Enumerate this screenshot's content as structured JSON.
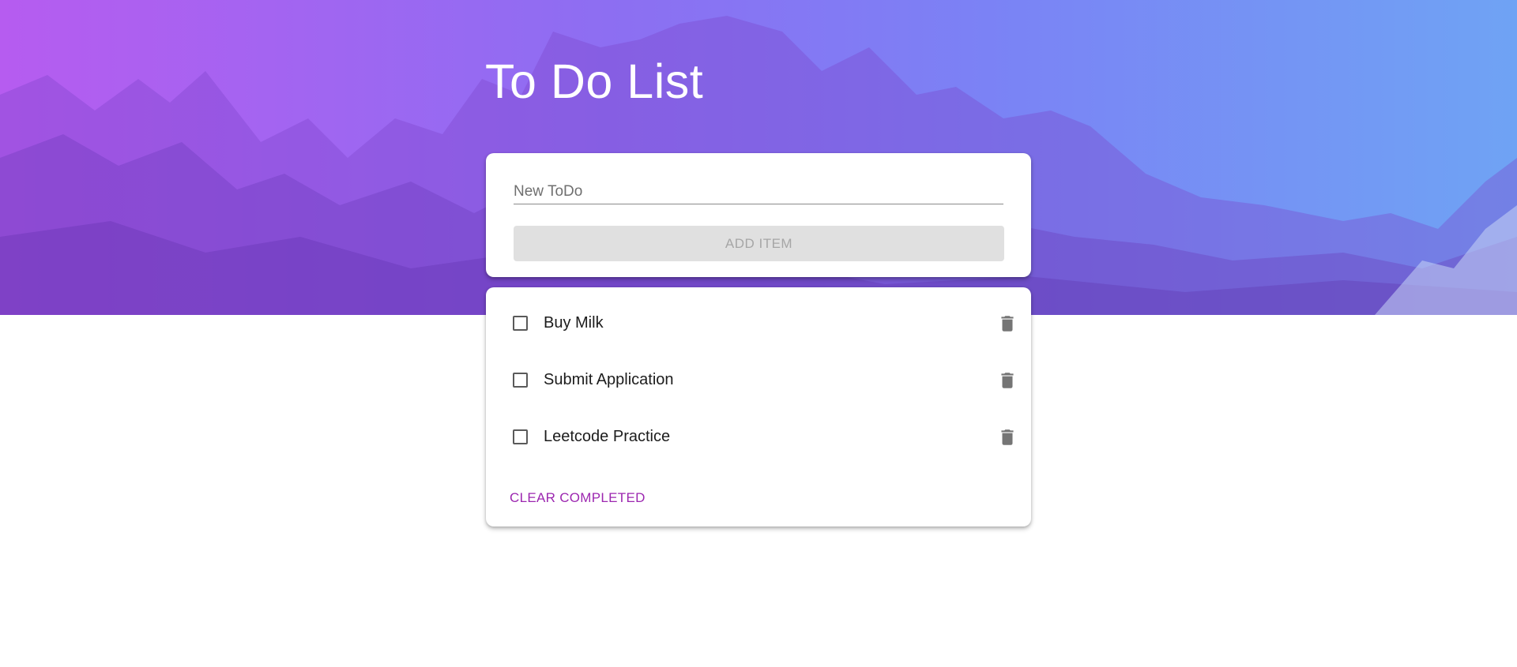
{
  "header": {
    "title": "To Do List"
  },
  "new_todo": {
    "placeholder": "New ToDo",
    "value": "",
    "add_button_label": "ADD ITEM"
  },
  "todos": [
    {
      "label": "Buy Milk",
      "completed": false
    },
    {
      "label": "Submit Application",
      "completed": false
    },
    {
      "label": "Leetcode Practice",
      "completed": false
    }
  ],
  "footer": {
    "clear_completed_label": "CLEAR COMPLETED"
  },
  "colors": {
    "accent": "#9c27b0",
    "gradient_start": "#b65cf0",
    "gradient_end": "#6fa3f4",
    "disabled_button_bg": "#e0e0e0",
    "disabled_button_text": "#a6a6a6",
    "icon": "#757575"
  },
  "icons": {
    "delete": "trash-icon",
    "checkbox": "checkbox-unchecked-icon"
  }
}
